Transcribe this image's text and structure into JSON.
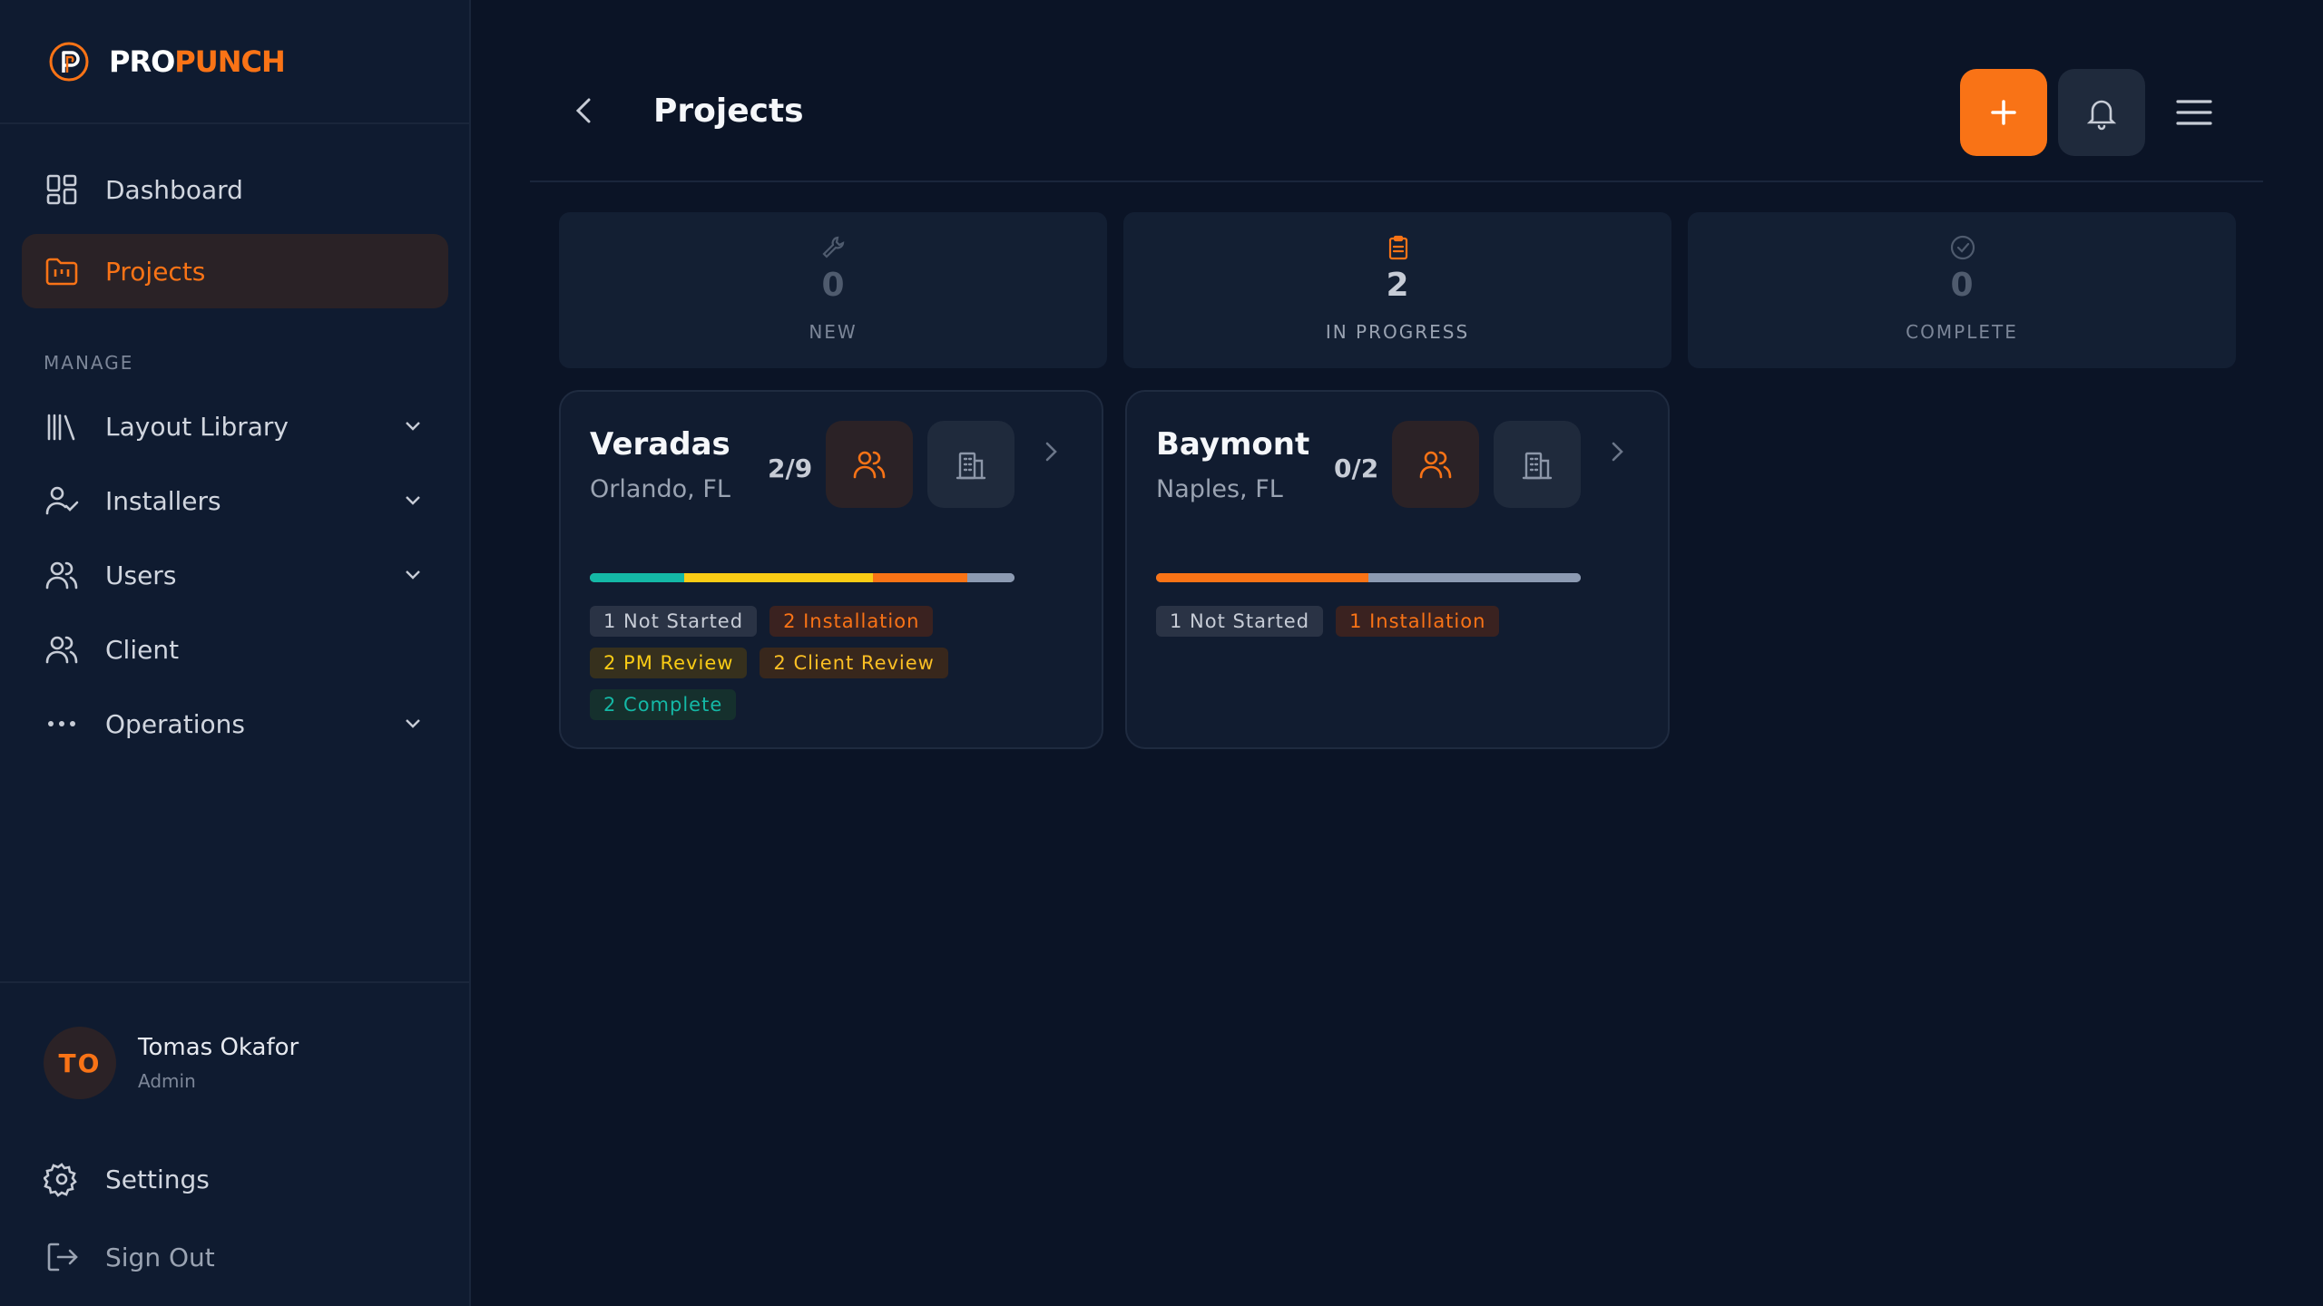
{
  "brand": {
    "pro": "PRO",
    "punch": "PUNCH"
  },
  "sidebar": {
    "nav": [
      {
        "label": "Dashboard",
        "icon": "dashboard-icon"
      },
      {
        "label": "Projects",
        "icon": "folder-icon"
      }
    ],
    "section_label": "MANAGE",
    "manage": [
      {
        "label": "Layout Library",
        "icon": "library-icon"
      },
      {
        "label": "Installers",
        "icon": "user-check-icon"
      },
      {
        "label": "Users",
        "icon": "users-icon"
      },
      {
        "label": "Client",
        "icon": "users-icon"
      },
      {
        "label": "Operations",
        "icon": "more-icon"
      }
    ],
    "user": {
      "initials": "TO",
      "name": "Tomas Okafor",
      "role": "Admin"
    },
    "settings_label": "Settings",
    "signout_label": "Sign Out"
  },
  "header": {
    "title": "Projects"
  },
  "stats": [
    {
      "value": "0",
      "label": "NEW"
    },
    {
      "value": "2",
      "label": "IN PROGRESS"
    },
    {
      "value": "0",
      "label": "COMPLETE"
    }
  ],
  "projects": [
    {
      "name": "Veradas",
      "location": "Orlando, FL",
      "count": "2/9",
      "progress": [
        {
          "fraction": 0.222,
          "color": "#14b8a6"
        },
        {
          "fraction": 0.444,
          "color": "#facc15"
        },
        {
          "fraction": 0.222,
          "color": "#f97316"
        },
        {
          "fraction": 0.112,
          "color": "#8c9ab2"
        }
      ],
      "tags": [
        {
          "label": "1 Not Started",
          "kind": "notstarted"
        },
        {
          "label": "2 Installation",
          "kind": "installation"
        },
        {
          "label": "2 PM Review",
          "kind": "pmreview"
        },
        {
          "label": "2 Client Review",
          "kind": "clientreview"
        },
        {
          "label": "2 Complete",
          "kind": "complete"
        }
      ]
    },
    {
      "name": "Baymont",
      "location": "Naples, FL",
      "count": "0/2",
      "progress": [
        {
          "fraction": 0.5,
          "color": "#f97316"
        },
        {
          "fraction": 0.5,
          "color": "#8c9ab2"
        }
      ],
      "tags": [
        {
          "label": "1 Not Started",
          "kind": "notstarted"
        },
        {
          "label": "1 Installation",
          "kind": "installation"
        }
      ]
    }
  ],
  "colors": {
    "accent": "#f97316",
    "background": "#0b1426",
    "sidebar": "#0f1b30"
  }
}
